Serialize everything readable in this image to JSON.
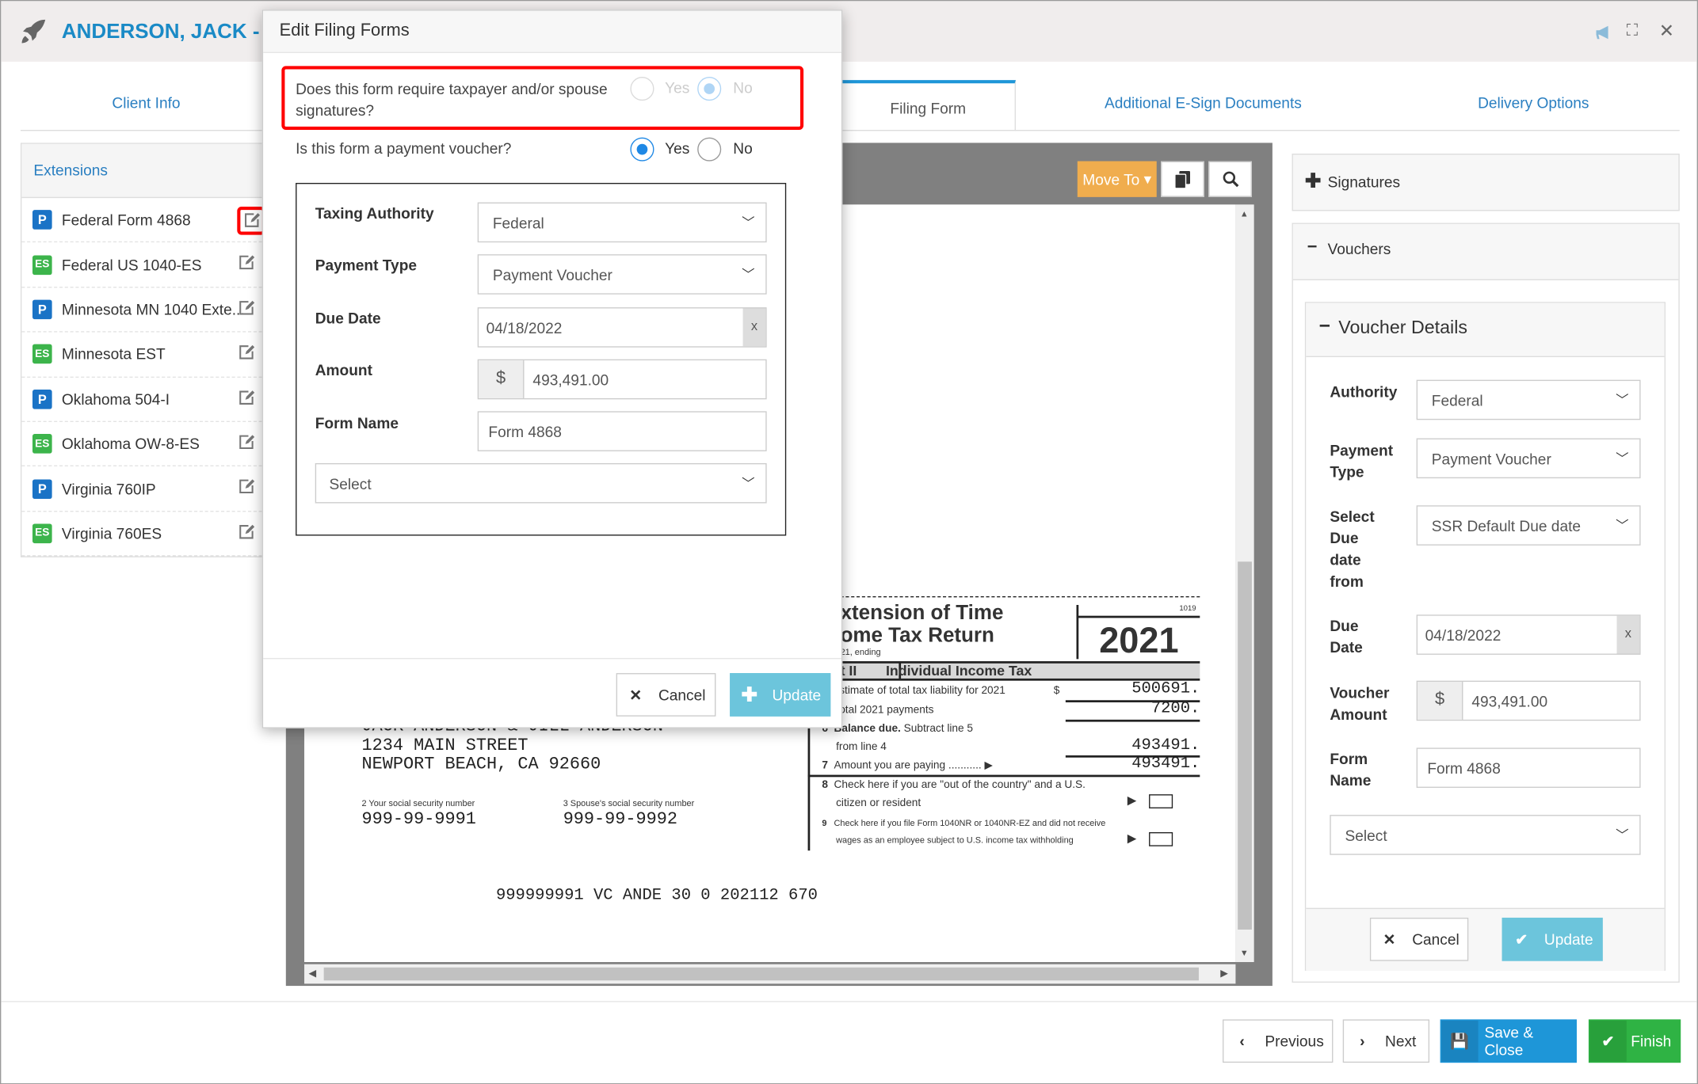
{
  "header": {
    "title": "ANDERSON, JACK - CC",
    "icons": [
      "rocket-icon",
      "megaphone-icon",
      "expand-icon",
      "close-icon"
    ]
  },
  "tabs": [
    {
      "label": "Client Info"
    },
    {
      "label": "Filing Form",
      "active": true
    },
    {
      "label": "Additional E-Sign Documents"
    },
    {
      "label": "Delivery Options"
    }
  ],
  "sidebar": {
    "title": "Extensions",
    "items": [
      {
        "badge": "P",
        "label": "Federal Form 4868"
      },
      {
        "badge": "ES",
        "label": "Federal US 1040-ES"
      },
      {
        "badge": "P",
        "label": "Minnesota MN 1040 Exte..."
      },
      {
        "badge": "ES",
        "label": "Minnesota EST"
      },
      {
        "badge": "P",
        "label": "Oklahoma 504-I"
      },
      {
        "badge": "ES",
        "label": "Oklahoma OW-8-ES"
      },
      {
        "badge": "P",
        "label": "Virginia 760IP"
      },
      {
        "badge": "ES",
        "label": "Virginia 760ES"
      }
    ]
  },
  "viewer": {
    "move_to": "Move To",
    "doc": {
      "title1": "xtension of Time",
      "title2": "ome Tax Return",
      "ending": "21, ending",
      "code": "1019",
      "year": "2021",
      "part": "t II",
      "part_title": "Individual Income Tax",
      "l4": "stimate of total tax liability for 2021",
      "l4_dollar": "$",
      "l4_val": "500691.",
      "l5": "otal 2021 payments",
      "l5_val": "7200.",
      "l6_num": "6",
      "l6a": "Balance due.",
      "l6b": "Subtract line 5",
      "l6c": "from line 4",
      "l6_val": "493491.",
      "l7_num": "7",
      "l7": "Amount you are paying",
      "l7_val": "493491.",
      "l8_num": "8",
      "l8a": "Check here if you are \"out of the country\" and a U.S.",
      "l8b": "citizen or resident",
      "l9_num": "9",
      "l9a": "Check here if you file Form 1040NR or 1040NR-EZ and did not receive",
      "l9b": "wages as an employee subject to U.S. income tax withholding",
      "addr1": "JACK ANDERSON & JILL ANDERSON",
      "addr2": "1234 MAIN STREET",
      "addr3": "NEWPORT BEACH, CA 92660",
      "ssn_label": "2  Your social security number",
      "ssn": "999-99-9991",
      "sp_label": "3  Spouse's social security number",
      "sp_ssn": "999-99-9992",
      "ocr": "999999991 VC ANDE 30 0 202112 670"
    }
  },
  "right": {
    "signatures": "Signatures",
    "vouchers": "Vouchers",
    "details_title": "Voucher Details",
    "authority_label": "Authority",
    "authority": "Federal",
    "ptype_label": "Payment Type",
    "ptype": "Payment Voucher",
    "duefrom_label": "Select Due date from",
    "duefrom": "SSR Default Due date",
    "due_label": "Due Date",
    "due": "04/18/2022",
    "clear": "x",
    "amount_label": "Voucher Amount",
    "currency": "$",
    "amount": "493,491.00",
    "form_label": "Form Name",
    "form": "Form 4868",
    "select": "Select",
    "cancel": "Cancel",
    "update": "Update"
  },
  "modal": {
    "title": "Edit Filing Forms",
    "q1": "Does this form require taxpayer and/or spouse signatures?",
    "q1_value": "No",
    "q1_disabled": true,
    "q2": "Is this form a payment voucher?",
    "q2_value": "Yes",
    "yes": "Yes",
    "no": "No",
    "authority_label": "Taxing Authority",
    "authority": "Federal",
    "ptype_label": "Payment Type",
    "ptype": "Payment Voucher",
    "due_label": "Due Date",
    "due": "04/18/2022",
    "clear": "x",
    "amount_label": "Amount",
    "currency": "$",
    "amount": "493,491.00",
    "form_label": "Form Name",
    "form": "Form 4868",
    "select": "Select",
    "cancel": "Cancel",
    "update": "Update"
  },
  "footer": {
    "previous": "Previous",
    "next": "Next",
    "save_close": "Save & Close",
    "finish": "Finish"
  },
  "colors": {
    "accent": "#1a8ac6",
    "move_to": "#f0ad4e",
    "save": "#1e96d8",
    "finish": "#2fb344",
    "update": "#5bc0de",
    "highlight": "#ff0000"
  }
}
